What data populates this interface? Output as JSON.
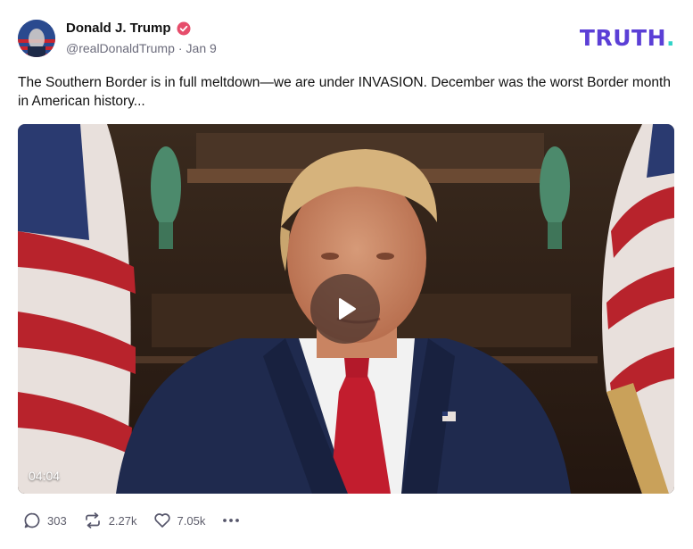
{
  "author": {
    "display_name": "Donald J. Trump",
    "handle": "@realDonaldTrump",
    "separator": "·",
    "date": "Jan 9",
    "verified_icon": "verified-badge-icon"
  },
  "brand": {
    "logo_text": "TRUTH",
    "logo_dot": ".",
    "colors": {
      "logo": "#5b3fd6",
      "dot": "#2fd3c8",
      "verified": "#e64d6b"
    }
  },
  "post": {
    "text": "The Southern Border is in full meltdown—we are under INVASION. December was the worst Border month in American history..."
  },
  "video": {
    "duration": "04:04",
    "play_icon": "play-icon"
  },
  "actions": {
    "reply_count": "303",
    "retruth_count": "2.27k",
    "like_count": "7.05k",
    "more_icon": "more-horizontal-icon"
  }
}
